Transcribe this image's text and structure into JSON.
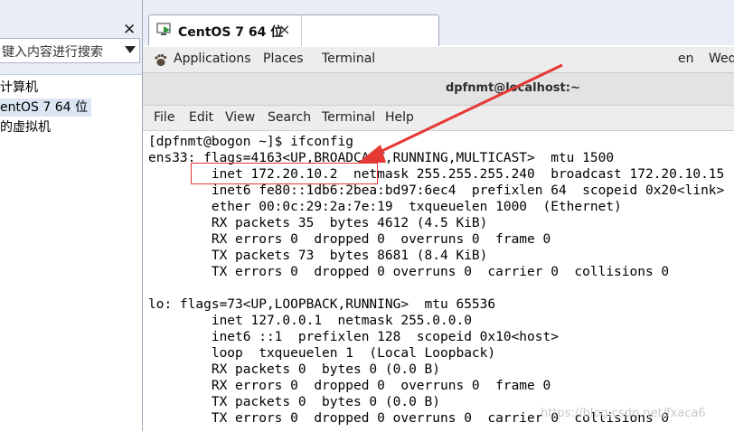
{
  "library": {
    "search_placeholder": "键入内容进行搜索",
    "tree": [
      "计算机",
      "entOS 7 64 位",
      "的虚拟机"
    ]
  },
  "vm_tab": {
    "label": "CentOS 7 64 位",
    "close": "×"
  },
  "gnome_bar": {
    "applications": "Applications",
    "places": "Places",
    "terminal": "Terminal",
    "language": "en",
    "clock": "Wed"
  },
  "terminal_window": {
    "title": "dpfnmt@localhost:~",
    "menu": [
      "File",
      "Edit",
      "View",
      "Search",
      "Terminal",
      "Help"
    ],
    "lines": [
      "[dpfnmt@bogon ~]$ ifconfig",
      "ens33: flags=4163<UP,BROADCAST,RUNNING,MULTICAST>  mtu 1500",
      "        inet 172.20.10.2  netmask 255.255.255.240  broadcast 172.20.10.15",
      "        inet6 fe80::1db6:2bea:bd97:6ec4  prefixlen 64  scopeid 0x20<link>",
      "        ether 00:0c:29:2a:7e:19  txqueuelen 1000  (Ethernet)",
      "        RX packets 35  bytes 4612 (4.5 KiB)",
      "        RX errors 0  dropped 0  overruns 0  frame 0",
      "        TX packets 73  bytes 8681 (8.4 KiB)",
      "        TX errors 0  dropped 0 overruns 0  carrier 0  collisions 0",
      "",
      "lo: flags=73<UP,LOOPBACK,RUNNING>  mtu 65536",
      "        inet 127.0.0.1  netmask 255.0.0.0",
      "        inet6 ::1  prefixlen 128  scopeid 0x10<host>",
      "        loop  txqueuelen 1  (Local Loopback)",
      "        RX packets 0  bytes 0 (0.0 B)",
      "        RX errors 0  dropped 0  overruns 0  frame 0",
      "        TX packets 0  bytes 0 (0.0 B)",
      "        TX errors 0  dropped 0 overruns 0  carrier 0  collisions 0"
    ]
  },
  "annotation": {
    "color": "#e53935"
  },
  "watermark": "https://blog.csdn.net/fxaca6"
}
